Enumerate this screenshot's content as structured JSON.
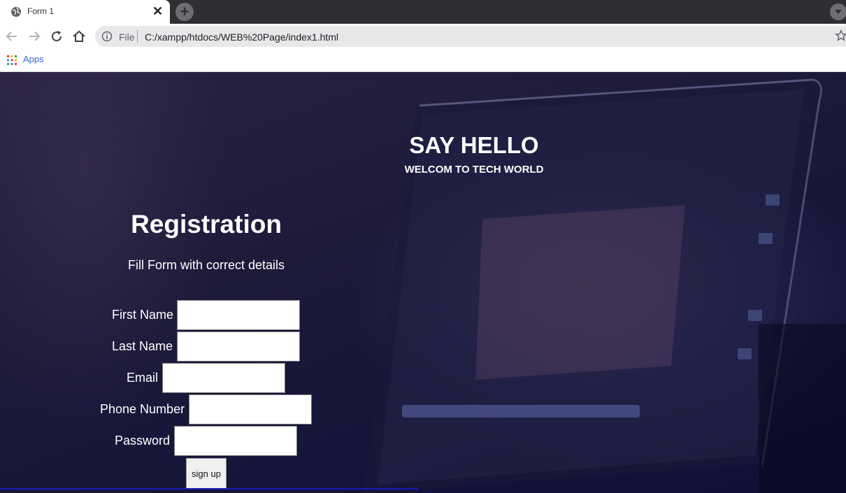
{
  "browser": {
    "tab_title": "Form 1",
    "address_prefix": "File",
    "address_url": "C:/xampp/htdocs/WEB%20Page/index1.html",
    "bookmarks": {
      "apps_label": "Apps"
    },
    "icons": {
      "favicon": "globe-icon",
      "close": "close-icon",
      "new_tab": "plus-icon",
      "back": "back-arrow-icon",
      "forward": "forward-arrow-icon",
      "reload": "reload-icon",
      "home": "home-icon",
      "info": "info-icon",
      "star": "star-icon",
      "apps": "apps-grid-icon"
    }
  },
  "hero": {
    "title": "SAY HELLO",
    "subtitle": "WELCOM TO TECH WORLD"
  },
  "registration": {
    "title": "Registration",
    "subtitle": "Fill Form with correct details",
    "fields": [
      {
        "label": "First Name",
        "value": ""
      },
      {
        "label": "Last Name",
        "value": ""
      },
      {
        "label": "Email",
        "value": ""
      },
      {
        "label": "Phone Number",
        "value": ""
      },
      {
        "label": "Password",
        "value": ""
      }
    ],
    "submit_label": "sign up"
  },
  "colors": {
    "text": "#ffffff",
    "page_background": "#1a1838",
    "chrome_dark": "#2f2f33",
    "link_blue": "#3367d6"
  }
}
